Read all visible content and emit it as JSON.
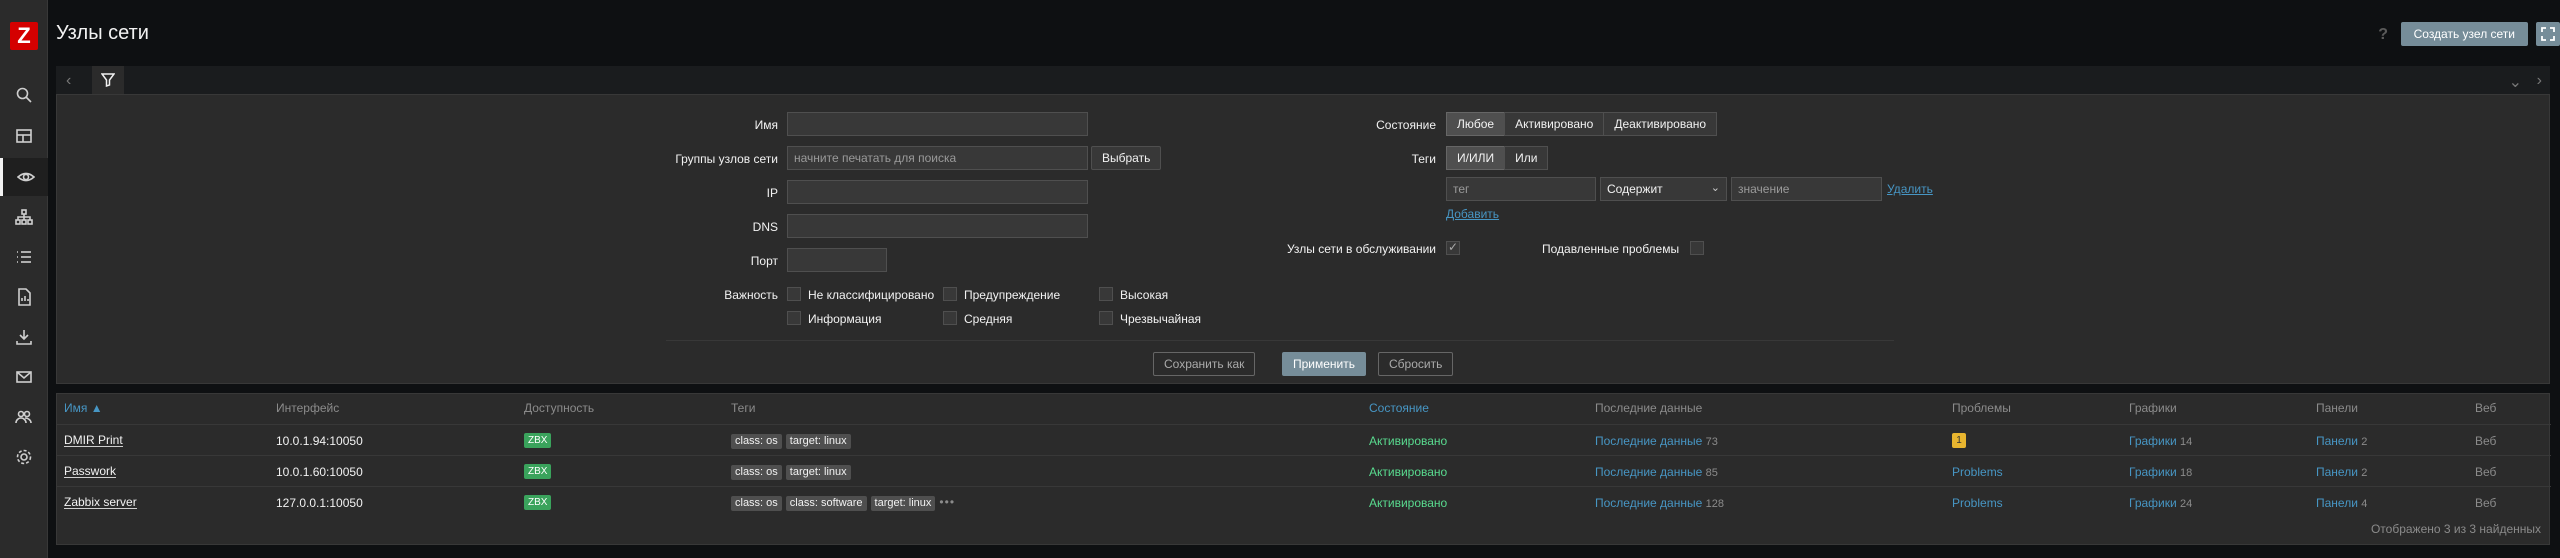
{
  "header": {
    "title": "Узлы сети",
    "help": "?",
    "create_button": "Создать узел сети"
  },
  "filter": {
    "name_label": "Имя",
    "groups_label": "Группы узлов сети",
    "groups_placeholder": "начните печатать для поиска",
    "select_button": "Выбрать",
    "ip_label": "IP",
    "dns_label": "DNS",
    "port_label": "Порт",
    "severity_label": "Важность",
    "severities": [
      "Не классифицировано",
      "Предупреждение",
      "Высокая",
      "Информация",
      "Средняя",
      "Чрезвычайная"
    ],
    "status_label": "Состояние",
    "status_options": [
      "Любое",
      "Активировано",
      "Деактивировано"
    ],
    "tags_label": "Теги",
    "tags_options": [
      "И/ИЛИ",
      "Или"
    ],
    "tag_placeholder": "тег",
    "operator_value": "Содержит",
    "value_placeholder": "значение",
    "remove_link": "Удалить",
    "add_link": "Добавить",
    "maintenance_label": "Узлы сети в обслуживании",
    "suppressed_label": "Подавленные проблемы",
    "save_as": "Сохранить как",
    "apply": "Применить",
    "reset": "Сбросить"
  },
  "table": {
    "headers": [
      "Имя ▲",
      "Интерфейс",
      "Доступность",
      "Теги",
      "Состояние",
      "Последние данные",
      "Проблемы",
      "Графики",
      "Панели",
      "Веб"
    ],
    "rows": [
      {
        "name": "DMIR Print",
        "interface": "10.0.1.94:10050",
        "availability": "ZBX",
        "tags": [
          "class: os",
          "target: linux"
        ],
        "status": "Активировано",
        "latest": "Последние данные",
        "latest_count": "73",
        "problems": "1",
        "graphs": "Графики",
        "graphs_count": "14",
        "dashboards": "Панели",
        "dashboards_count": "2",
        "web": "Веб"
      },
      {
        "name": "Passwork",
        "interface": "10.0.1.60:10050",
        "availability": "ZBX",
        "tags": [
          "class: os",
          "target: linux"
        ],
        "status": "Активировано",
        "latest": "Последние данные",
        "latest_count": "85",
        "problems": "Problems",
        "graphs": "Графики",
        "graphs_count": "18",
        "dashboards": "Панели",
        "dashboards_count": "2",
        "web": "Веб"
      },
      {
        "name": "Zabbix server",
        "interface": "127.0.0.1:10050",
        "availability": "ZBX",
        "tags": [
          "class: os",
          "class: software",
          "target: linux"
        ],
        "more": "•••",
        "status": "Активировано",
        "latest": "Последние данные",
        "latest_count": "128",
        "problems": "Problems",
        "graphs": "Графики",
        "graphs_count": "24",
        "dashboards": "Панели",
        "dashboards_count": "4",
        "web": "Веб"
      }
    ],
    "footer": "Отображено 3 из 3 найденных"
  },
  "colors": {
    "accent": "#768d99",
    "link": "#4796c4",
    "enabled": "#59db8f",
    "zbx": "#3aa35c",
    "problem": "#e8b52f",
    "logo": "#d40000"
  }
}
